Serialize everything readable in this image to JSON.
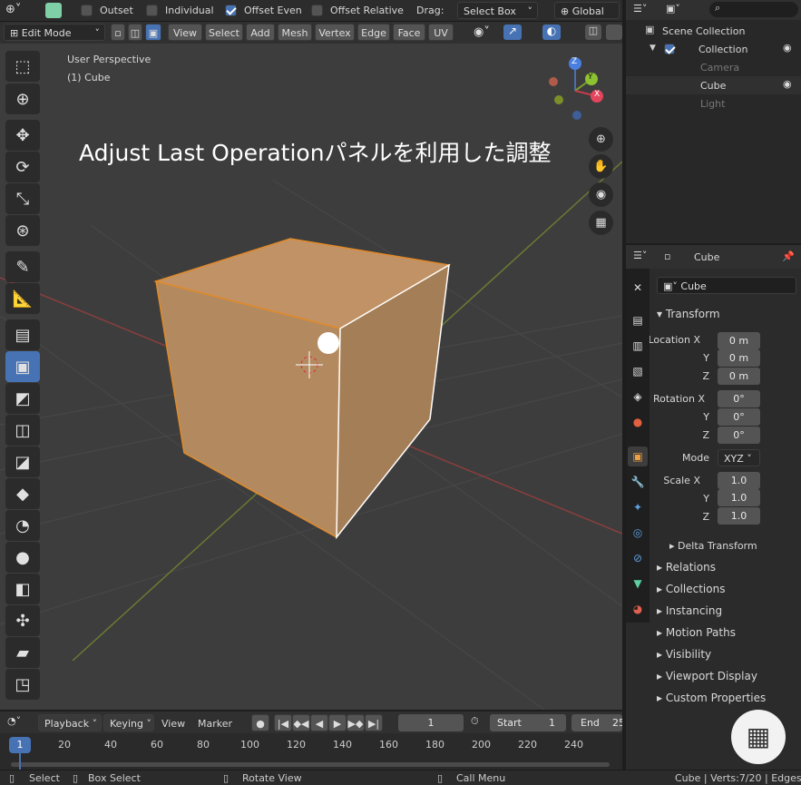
{
  "toolbar": {
    "outset_label": "Outset",
    "individual_label": "Individual",
    "offset_even_label": "Offset Even",
    "offset_relative_label": "Offset Relative",
    "drag_label": "Drag:",
    "drag_value": "Select Box",
    "orientation_value": "Global"
  },
  "header": {
    "mode_value": "Edit Mode",
    "menus": [
      "View",
      "Select",
      "Add",
      "Mesh",
      "Vertex",
      "Edge",
      "Face",
      "UV"
    ]
  },
  "viewport": {
    "perspective_label": "User Perspective",
    "object_label": "(1) Cube",
    "overlay_text": "Adjust Last Operationパネルを利用した調整",
    "gizmo_x": "X",
    "gizmo_y": "Y",
    "gizmo_z": "Z"
  },
  "outliner": {
    "root": "Scene Collection",
    "collection": "Collection",
    "items": [
      "Camera",
      "Cube",
      "Light"
    ]
  },
  "properties": {
    "context_title": "Cube",
    "object_name": "Cube",
    "transform_title": "Transform",
    "location_label": "Location X",
    "rotation_label": "Rotation X",
    "scale_label": "Scale X",
    "y_label": "Y",
    "z_label": "Z",
    "location": [
      "0 m",
      "0 m",
      "0 m"
    ],
    "rotation": [
      "0°",
      "0°",
      "0°"
    ],
    "scale": [
      "1.0",
      "1.0",
      "1.0"
    ],
    "mode_label": "Mode",
    "mode_value": "XYZ",
    "delta_title": "Delta Transform",
    "sections": [
      "Relations",
      "Collections",
      "Instancing",
      "Motion Paths",
      "Visibility",
      "Viewport Display",
      "Custom Properties"
    ]
  },
  "timeline": {
    "playback": "Playback",
    "keying": "Keying",
    "view": "View",
    "marker": "Marker",
    "current_frame": "1",
    "start_label": "Start",
    "start_value": "1",
    "end_label": "End",
    "end_value": "25",
    "ticks": [
      "1",
      "20",
      "40",
      "60",
      "80",
      "100",
      "120",
      "140",
      "160",
      "180",
      "200",
      "220",
      "240"
    ]
  },
  "status": {
    "select": "Select",
    "box_select": "Box Select",
    "rotate_view": "Rotate View",
    "call_menu": "Call Menu",
    "stats": "Cube | Verts:7/20 | Edges:9/"
  },
  "colors": {
    "accent": "#4772b3",
    "cube_face": "#b38a5f",
    "viewport_bg": "#3d3d3d"
  }
}
